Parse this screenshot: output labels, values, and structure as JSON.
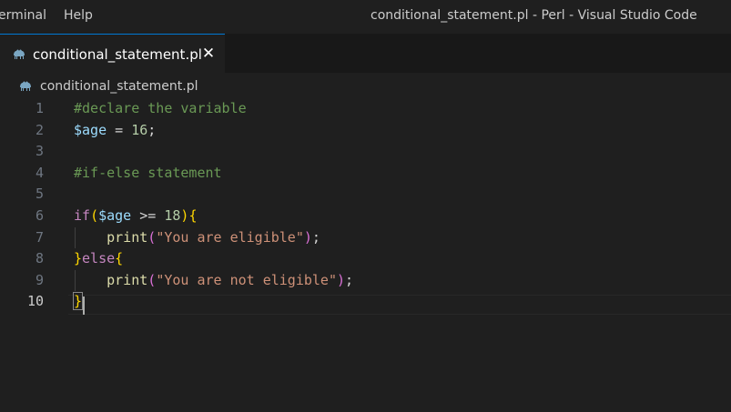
{
  "menu": {
    "terminal": "erminal",
    "help": "Help"
  },
  "window": {
    "title": "conditional_statement.pl - Perl - Visual Studio Code"
  },
  "tab": {
    "label": "conditional_statement.pl",
    "close": "✕",
    "icon": "perl-camel-icon"
  },
  "breadcrumb": {
    "label": "conditional_statement.pl",
    "icon": "perl-camel-icon"
  },
  "editor": {
    "active_line": 10,
    "lines": [
      {
        "num": "1",
        "tokens": [
          {
            "t": "#declare the variable",
            "c": "comment"
          }
        ]
      },
      {
        "num": "2",
        "tokens": [
          {
            "t": "$age",
            "c": "var"
          },
          {
            "t": " = ",
            "c": "op"
          },
          {
            "t": "16",
            "c": "num"
          },
          {
            "t": ";",
            "c": "op"
          }
        ]
      },
      {
        "num": "3",
        "tokens": []
      },
      {
        "num": "4",
        "tokens": [
          {
            "t": "#if-else statement",
            "c": "comment"
          }
        ]
      },
      {
        "num": "5",
        "tokens": []
      },
      {
        "num": "6",
        "tokens": [
          {
            "t": "if",
            "c": "kw"
          },
          {
            "t": "(",
            "c": "br1"
          },
          {
            "t": "$age",
            "c": "var"
          },
          {
            "t": " >= ",
            "c": "op"
          },
          {
            "t": "18",
            "c": "num"
          },
          {
            "t": ")",
            "c": "br1"
          },
          {
            "t": "{",
            "c": "br1"
          }
        ]
      },
      {
        "num": "7",
        "tokens": [
          {
            "t": "    ",
            "c": "op"
          },
          {
            "t": "print",
            "c": "fn"
          },
          {
            "t": "(",
            "c": "br2"
          },
          {
            "t": "\"You are eligible\"",
            "c": "str"
          },
          {
            "t": ")",
            "c": "br2"
          },
          {
            "t": ";",
            "c": "op"
          }
        ]
      },
      {
        "num": "8",
        "tokens": [
          {
            "t": "}",
            "c": "br1"
          },
          {
            "t": "else",
            "c": "kw"
          },
          {
            "t": "{",
            "c": "br1"
          }
        ]
      },
      {
        "num": "9",
        "tokens": [
          {
            "t": "    ",
            "c": "op"
          },
          {
            "t": "print",
            "c": "fn"
          },
          {
            "t": "(",
            "c": "br2"
          },
          {
            "t": "\"You are not eligible\"",
            "c": "str"
          },
          {
            "t": ")",
            "c": "br2"
          },
          {
            "t": ";",
            "c": "op"
          }
        ]
      },
      {
        "num": "10",
        "tokens": [
          {
            "t": "}",
            "c": "br1"
          }
        ]
      }
    ]
  },
  "colors": {
    "background": "#1f1f1f",
    "tab_accent": "#0078d4",
    "comment": "#6a9955",
    "variable": "#9cdcfe",
    "number": "#b5cea8",
    "keyword": "#c586c0",
    "function": "#dcdcaa",
    "string": "#ce9178",
    "bracket_level1": "#ffd700",
    "bracket_level2": "#da70d6"
  }
}
